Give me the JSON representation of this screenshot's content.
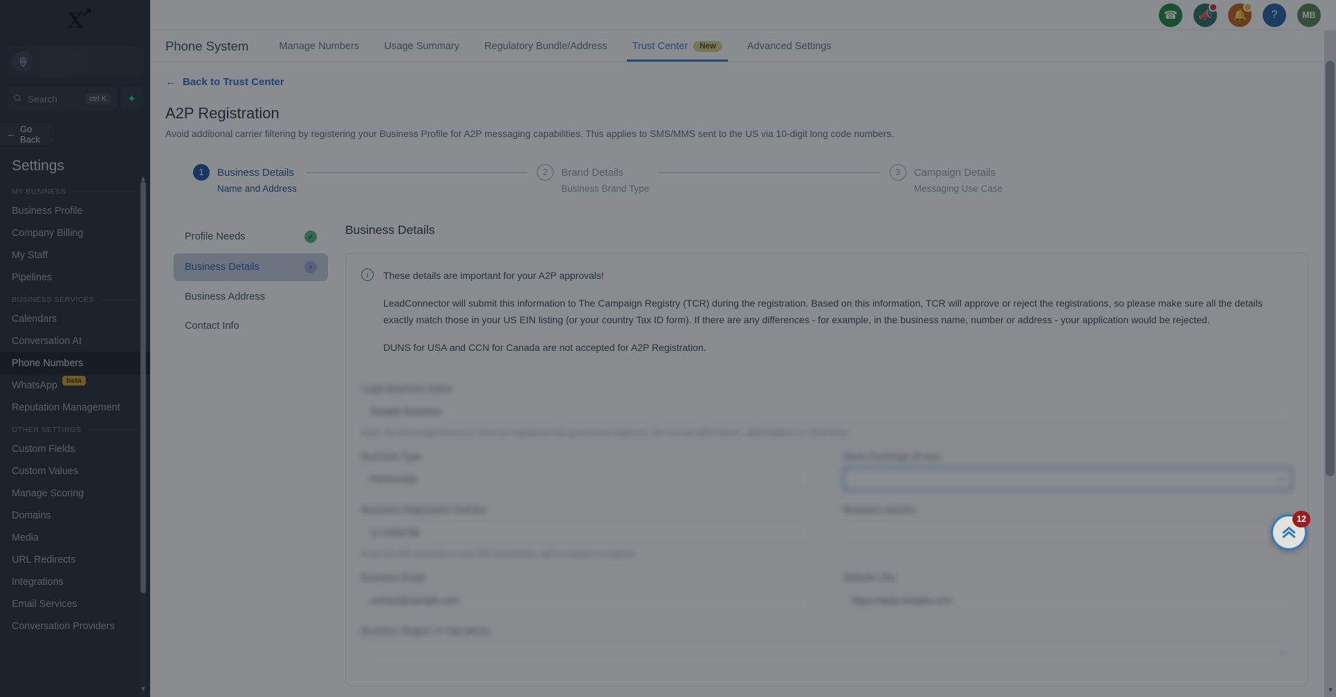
{
  "sidebar": {
    "logo": "X",
    "search": {
      "placeholder": "Search",
      "shortcut": "ctrl K",
      "spark_icon": "sparkle-icon"
    },
    "go_back": "Go Back",
    "title": "Settings",
    "groups": [
      {
        "label": "MY BUSINESS",
        "items": [
          {
            "label": "Business Profile"
          },
          {
            "label": "Company Billing"
          },
          {
            "label": "My Staff"
          },
          {
            "label": "Pipelines"
          }
        ]
      },
      {
        "label": "BUSINESS SERVICES",
        "items": [
          {
            "label": "Calendars"
          },
          {
            "label": "Conversation AI"
          },
          {
            "label": "Phone Numbers",
            "active": true
          },
          {
            "label": "WhatsApp",
            "badge": "beta"
          },
          {
            "label": "Reputation Management"
          }
        ]
      },
      {
        "label": "OTHER SETTINGS",
        "items": [
          {
            "label": "Custom Fields"
          },
          {
            "label": "Custom Values"
          },
          {
            "label": "Manage Scoring"
          },
          {
            "label": "Domains"
          },
          {
            "label": "Media"
          },
          {
            "label": "URL Redirects"
          },
          {
            "label": "Integrations"
          },
          {
            "label": "Email Services"
          },
          {
            "label": "Conversation Providers"
          }
        ]
      }
    ]
  },
  "topbar": {
    "icons": [
      {
        "name": "phone-icon",
        "glyph": "☎",
        "color": "#128238"
      },
      {
        "name": "announcement-icon",
        "glyph": "📣",
        "color": "#1f6a5a",
        "dot": "#d32222"
      },
      {
        "name": "notifications-bell-icon",
        "glyph": "🔔",
        "color": "#c25610",
        "dot": "#e8b521"
      },
      {
        "name": "help-icon",
        "glyph": "?",
        "color": "#17599e"
      }
    ],
    "avatar": {
      "initials": "MB",
      "color": "#4b7a52"
    }
  },
  "tabs": {
    "section_title": "Phone System",
    "items": [
      {
        "label": "Manage Numbers"
      },
      {
        "label": "Usage Summary"
      },
      {
        "label": "Regulatory Bundle/Address"
      },
      {
        "label": "Trust Center",
        "active": true,
        "badge": "New"
      },
      {
        "label": "Advanced Settings"
      }
    ]
  },
  "page": {
    "back_link": "Back to Trust Center",
    "title": "A2P Registration",
    "subtitle": "Avoid additional carrier filtering by registering your Business Profile for A2P messaging capabilities. This applies to SMS/MMS sent to the US via 10-digit long code numbers."
  },
  "stepper": [
    {
      "num": "1",
      "label": "Business Details",
      "sub": "Name and Address",
      "state": "on"
    },
    {
      "num": "2",
      "label": "Brand Details",
      "sub": "Business Brand Type",
      "state": "off"
    },
    {
      "num": "3",
      "label": "Campaign Details",
      "sub": "Messaging Use Case",
      "state": "off"
    }
  ],
  "subnav": [
    {
      "label": "Profile Needs",
      "status": "check"
    },
    {
      "label": "Business Details",
      "status": "chevron",
      "selected": true
    },
    {
      "label": "Business Address",
      "status": "none"
    },
    {
      "label": "Contact Info",
      "status": "none"
    }
  ],
  "panel": {
    "heading": "Business Details",
    "alert": {
      "title": "These details are important for your A2P approvals!",
      "paragraph1": "LeadConnector will submit this information to The Campaign Registry (TCR) during the registration. Based on this information, TCR will approve or reject the registrations, so please make sure all the details exactly match those in your US EIN listing (or your country Tax ID form). If there are any differences - for example, in the business name, number or address - your application would be rejected.",
      "paragraph2": "DUNS for USA and CCN for Canada are not accepted for A2P Registration."
    },
    "form": {
      "rows": [
        {
          "fields": [
            {
              "label": "Legal Business Name",
              "value": "Sample Business",
              "hint": "Enter the exact legal business name as registered with government agencies. Do not use DBA names, abbreviations or nicknames.",
              "full": true
            }
          ]
        },
        {
          "fields": [
            {
              "label": "Business Type",
              "value": "Partnership",
              "type": "text"
            },
            {
              "label": "Stock Exchange (if any)",
              "value": "",
              "type": "select",
              "focused": true
            }
          ]
        },
        {
          "fields": [
            {
              "label": "Business Registration Number",
              "value": "12-3456789",
              "hint": "Enter the EIN as listed on your IRS documents, with no spaces or dashes.",
              "type": "text"
            },
            {
              "label": "Business Industry",
              "value": "",
              "type": "select"
            }
          ]
        },
        {
          "fields": [
            {
              "label": "Business Email",
              "value": "contact@sample.com",
              "type": "text"
            },
            {
              "label": "Website URL",
              "value": "https://www.sample.com",
              "type": "text"
            }
          ]
        },
        {
          "fields": [
            {
              "label": "Business Region of Operations",
              "value": "",
              "type": "select",
              "full": true
            }
          ]
        }
      ]
    }
  },
  "fab": {
    "icon": "double-chevron-up-icon",
    "badge": "12"
  }
}
